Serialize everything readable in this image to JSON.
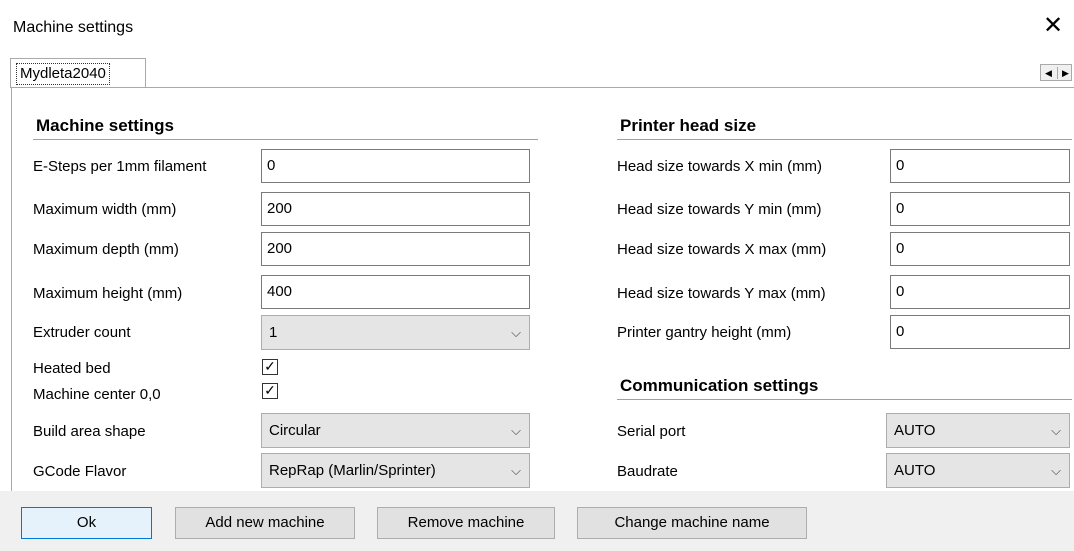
{
  "window": {
    "title": "Machine settings",
    "close_glyph": "✕"
  },
  "tabs": [
    {
      "label": "Mydleta2040",
      "selected": true
    }
  ],
  "machine_settings": {
    "title": "Machine settings",
    "e_steps": {
      "label": "E-Steps per 1mm filament",
      "value": "0"
    },
    "max_width": {
      "label": "Maximum width (mm)",
      "value": "200"
    },
    "max_depth": {
      "label": "Maximum depth (mm)",
      "value": "200"
    },
    "max_height": {
      "label": "Maximum height (mm)",
      "value": "400"
    },
    "extruder_count": {
      "label": "Extruder count",
      "value": "1"
    },
    "heated_bed": {
      "label": "Heated bed",
      "checked": true
    },
    "machine_center": {
      "label": "Machine center 0,0",
      "checked": true
    },
    "build_area_shape": {
      "label": "Build area shape",
      "value": "Circular"
    },
    "gcode_flavor": {
      "label": "GCode Flavor",
      "value": "RepRap (Marlin/Sprinter)"
    }
  },
  "printer_head": {
    "title": "Printer head size",
    "x_min": {
      "label": "Head size towards X min (mm)",
      "value": "0"
    },
    "y_min": {
      "label": "Head size towards Y min (mm)",
      "value": "0"
    },
    "x_max": {
      "label": "Head size towards X max (mm)",
      "value": "0"
    },
    "y_max": {
      "label": "Head size towards Y max (mm)",
      "value": "0"
    },
    "gantry_height": {
      "label": "Printer gantry height (mm)",
      "value": "0"
    }
  },
  "communication": {
    "title": "Communication settings",
    "serial_port": {
      "label": "Serial port",
      "value": "AUTO"
    },
    "baudrate": {
      "label": "Baudrate",
      "value": "AUTO"
    }
  },
  "buttons": {
    "ok": "Ok",
    "add_machine": "Add new machine",
    "remove_machine": "Remove machine",
    "change_name": "Change machine name"
  },
  "glyphs": {
    "check": "✓",
    "chevron": "⌵",
    "scroll_left": "◀",
    "scroll_right": "▶"
  }
}
